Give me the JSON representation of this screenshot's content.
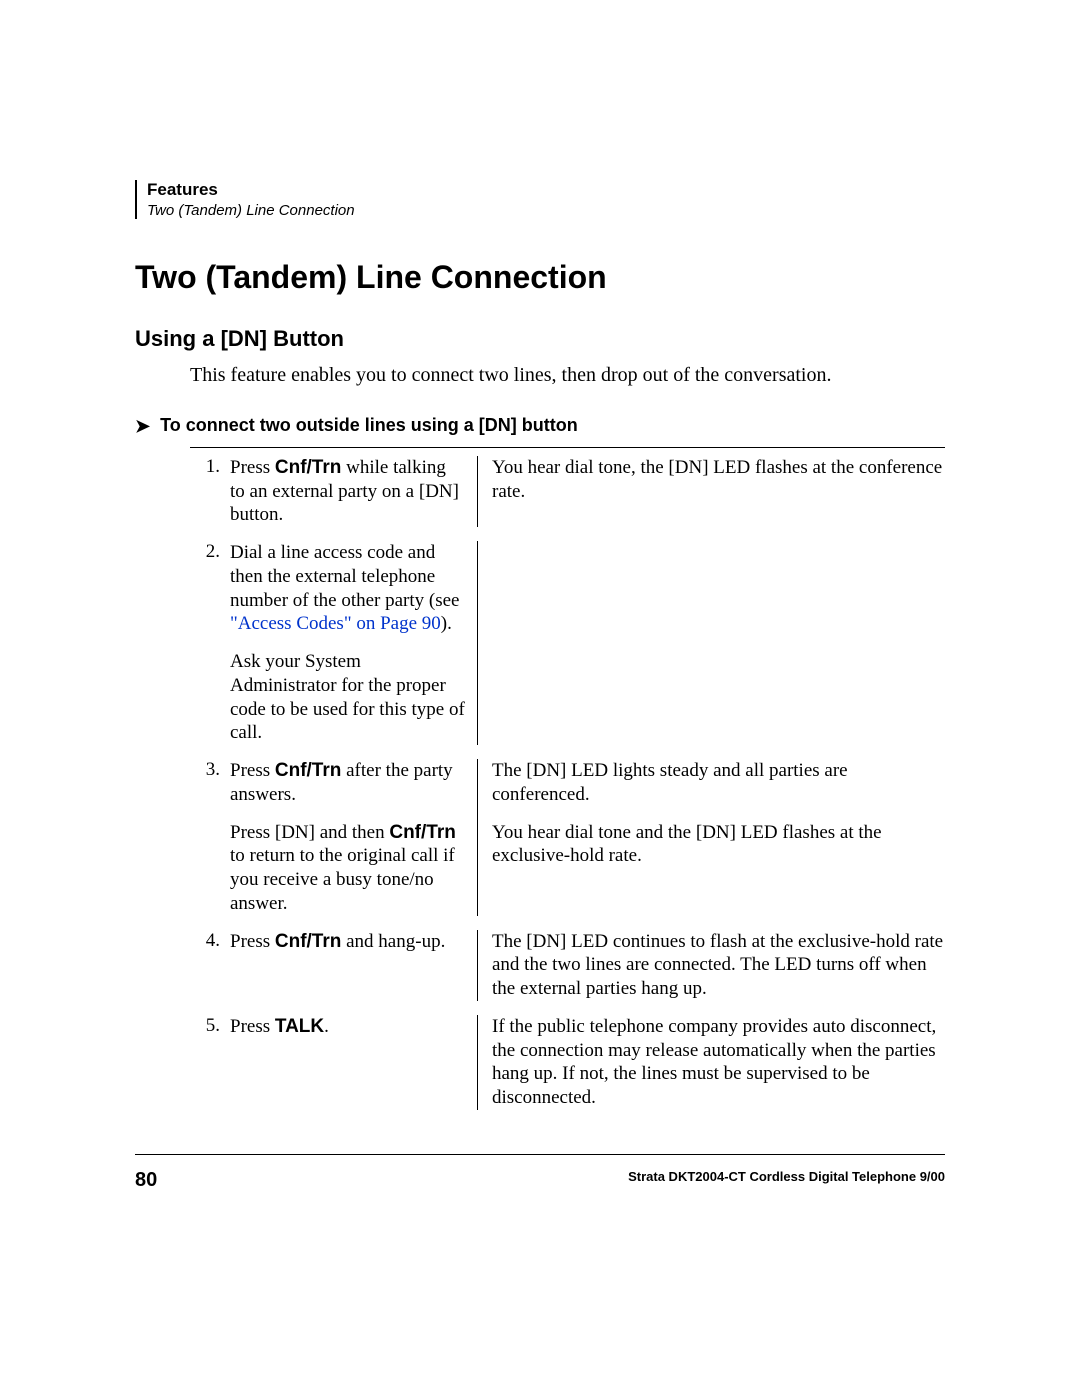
{
  "header": {
    "section": "Features",
    "subsection": "Two (Tandem) Line Connection"
  },
  "title": "Two (Tandem) Line Connection",
  "subtitle": "Using a [DN] Button",
  "intro": "This feature enables you to connect two lines, then drop out of the conversation.",
  "procedure_heading": "To connect two outside lines using a [DN] button",
  "steps": [
    {
      "num": "1.",
      "action_pre": "Press ",
      "action_bold": "Cnf/Trn",
      "action_post": " while talking to an external party on a [DN] button.",
      "sub": "",
      "result": "You hear dial tone, the [DN] LED flashes at the conference rate."
    },
    {
      "num": "2.",
      "action_pre": "Dial a line access code and then the external telephone number of the other party (see ",
      "link": "\"Access Codes\" on Page 90",
      "action_post2": ").",
      "sub": "Ask your System Administrator for the proper code to be used for this type of call.",
      "result": ""
    },
    {
      "num": "3.",
      "action_pre": "Press ",
      "action_bold": "Cnf/Trn",
      "action_post": " after the party answers.",
      "sub_pre": "Press [DN] and then ",
      "sub_bold": "Cnf/Trn",
      "sub_post": " to return to the original call if you receive a busy tone/no answer.",
      "result": "The [DN] LED lights steady and all parties are conferenced.",
      "result2": "You hear dial tone and the [DN] LED flashes at the exclusive-hold rate."
    },
    {
      "num": "4.",
      "action_pre": "Press ",
      "action_bold": "Cnf/Trn",
      "action_post": " and hang-up.",
      "result": "The [DN] LED continues to flash at the exclusive-hold rate and the two lines are connected. The LED turns off when the external parties hang up."
    },
    {
      "num": "5.",
      "action_pre": "Press ",
      "action_bold": "TALK",
      "action_post": ".",
      "result": "If the public telephone company provides auto disconnect, the connection may release automatically when the parties hang up. If not, the lines must be supervised to be disconnected."
    }
  ],
  "footer": {
    "page": "80",
    "doc_title": "Strata DKT2004-CT Cordless Digital Telephone   9/00"
  }
}
